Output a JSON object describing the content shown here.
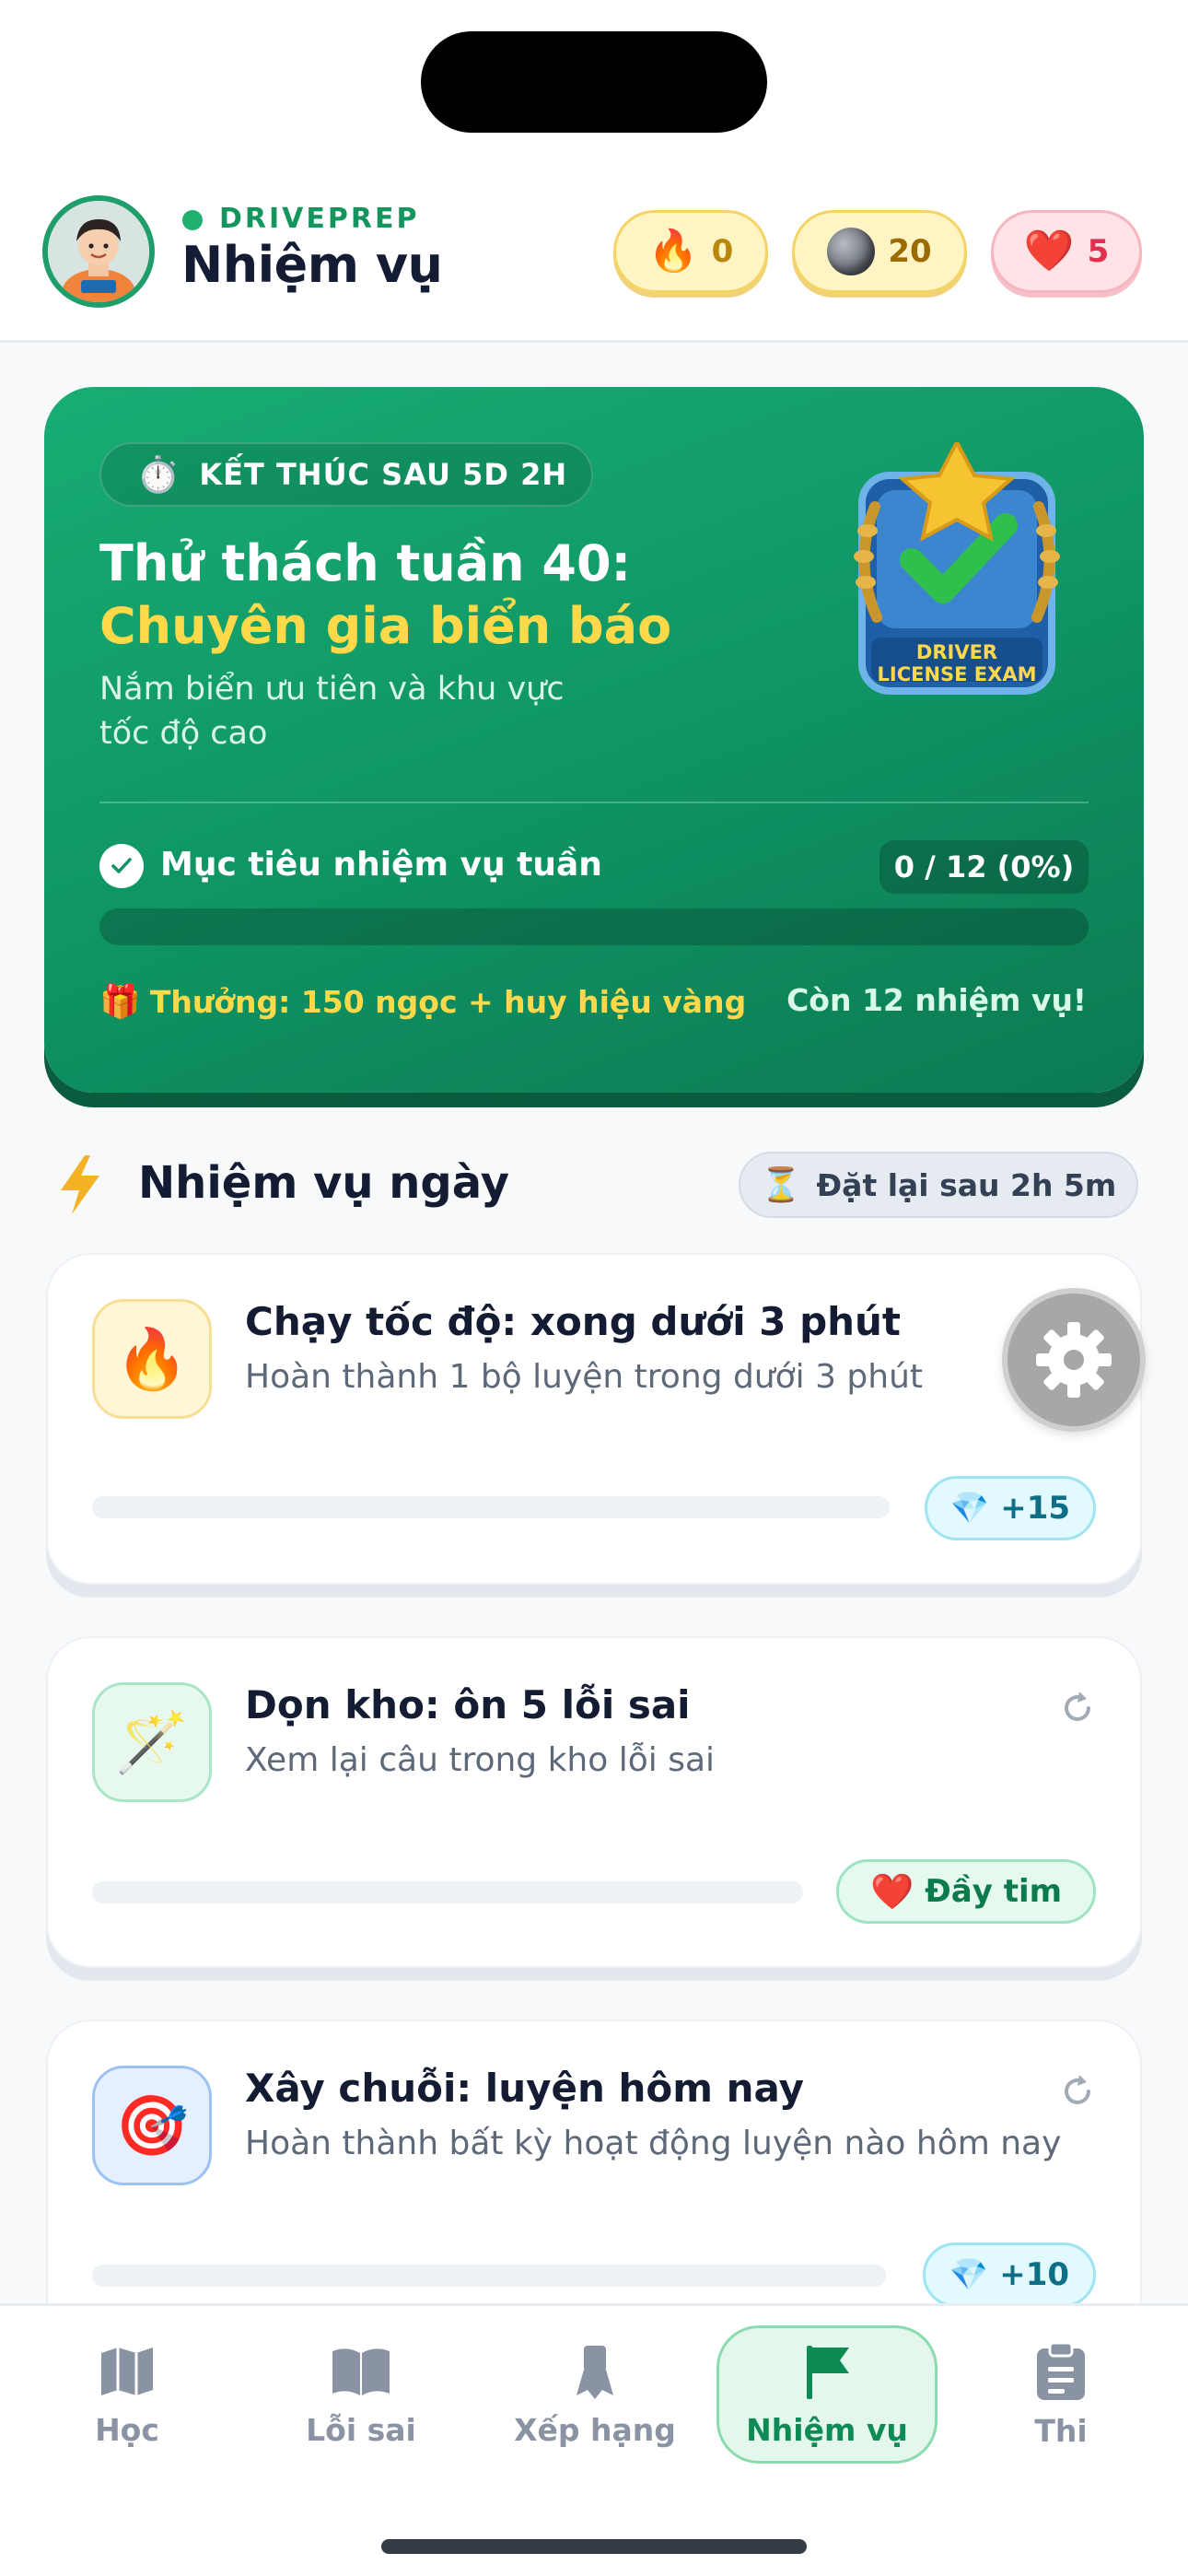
{
  "header": {
    "brand": "DRIVEPREP",
    "title": "Nhiệm vụ",
    "streak": "0",
    "gems": "20",
    "hearts": "5"
  },
  "weekly": {
    "timer": "KẾT THÚC SAU 5D 2H",
    "title_line1": "Thử thách tuần 40:",
    "title_line2": "Chuyên gia biển báo",
    "description": "Nắm biển ưu tiên và khu vực tốc độ cao",
    "badge_text": "DRIVER LICENSE EXAM",
    "goal_label": "Mục tiêu nhiệm vụ tuần",
    "goal_count": "0 / 12 (0%)",
    "goal_progress": 0,
    "reward": "Thưởng: 150 ngọc + huy hiệu vàng",
    "remaining": "Còn 12 nhiệm vụ!"
  },
  "daily": {
    "title": "Nhiệm vụ ngày",
    "reset": "Đặt lại sau 2h 5m",
    "quests": [
      {
        "icon": "fire-icon",
        "title": "Chạy tốc độ: xong dưới 3 phút",
        "subtitle": "Hoàn thành 1 bộ luyện trong dưới 3 phút",
        "reward": "+15",
        "progress": 0
      },
      {
        "icon": "magic-wand-icon",
        "title": "Dọn kho: ôn 5 lỗi sai",
        "subtitle": "Xem lại câu trong kho lỗi sai",
        "reward": "Đầy tim",
        "progress": 0
      },
      {
        "icon": "target-icon",
        "title": "Xây chuỗi: luyện hôm nay",
        "subtitle": "Hoàn thành bất kỳ hoạt động luyện nào hôm nay",
        "reward": "+10",
        "progress": 0
      }
    ]
  },
  "nav": {
    "items": [
      {
        "label": "Học",
        "icon": "map-icon"
      },
      {
        "label": "Lỗi sai",
        "icon": "book-icon"
      },
      {
        "label": "Xếp hạng",
        "icon": "ribbon-icon"
      },
      {
        "label": "Nhiệm vụ",
        "icon": "flag-icon"
      },
      {
        "label": "Thi",
        "icon": "clipboard-icon"
      }
    ],
    "active": "Nhiệm vụ"
  },
  "colors": {
    "brand_green": "#14955d",
    "weekly_bg": "#0f9363",
    "accent_yellow": "#ffd94a",
    "heart_red": "#e0304e"
  }
}
